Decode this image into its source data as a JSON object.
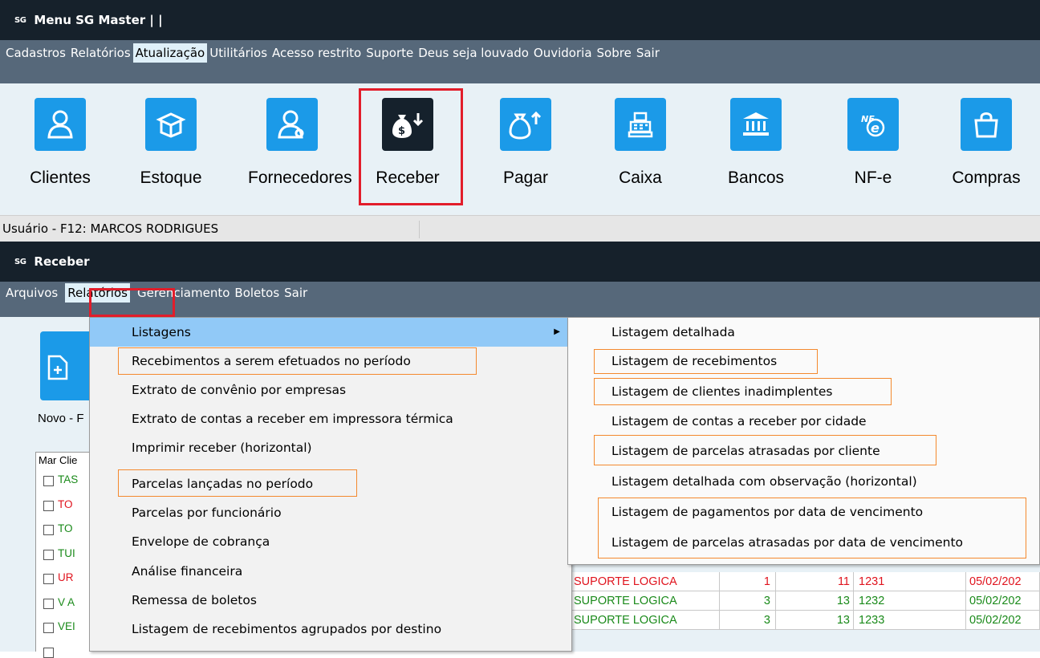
{
  "main_window": {
    "logo": "SG",
    "title": "Menu SG Master | |",
    "menu": [
      "Cadastros",
      "Relatórios",
      "Atualização",
      "Utilitários",
      "Acesso restrito",
      "Suporte",
      "Deus seja louvado",
      "Ouvidoria",
      "Sobre",
      "Sair"
    ],
    "selected_menu": "Atualização",
    "tools": [
      {
        "label": "Clientes",
        "icon": "user-icon"
      },
      {
        "label": "Estoque",
        "icon": "box-icon"
      },
      {
        "label": "Fornecedores",
        "icon": "supplier-icon"
      },
      {
        "label": "Receber",
        "icon": "money-bag-down-icon"
      },
      {
        "label": "Pagar",
        "icon": "money-bag-up-icon"
      },
      {
        "label": "Caixa",
        "icon": "cash-register-icon"
      },
      {
        "label": "Bancos",
        "icon": "bank-icon"
      },
      {
        "label": "NF-e",
        "icon": "nfe-icon"
      },
      {
        "label": "Compras",
        "icon": "shopping-bag-icon"
      }
    ],
    "status": "Usuário - F12: MARCOS RODRIGUES"
  },
  "receber_window": {
    "logo": "SG",
    "title": "Receber",
    "menu": [
      "Arquivos",
      "Relatórios",
      "Gerenciamento",
      "Boletos",
      "Sair"
    ],
    "new_button_label": "Novo - F",
    "grid_header": "Mar Clie",
    "grid_rows": [
      {
        "client": "TAS",
        "color": "#1a8a1a"
      },
      {
        "client": "TO",
        "color": "#e0141e"
      },
      {
        "client": "TO",
        "color": "#1a8a1a"
      },
      {
        "client": "TUI",
        "color": "#1a8a1a"
      },
      {
        "client": "UR",
        "color": "#e0141e"
      },
      {
        "client": "V A",
        "color": "#1a8a1a"
      },
      {
        "client": "VEI",
        "color": "#1a8a1a"
      },
      {
        "client": "",
        "color": "#1a8a1a"
      }
    ],
    "grid_visible_rows": [
      {
        "dest": "SUPORTE LOGICA",
        "a": "1",
        "b": "11",
        "doc": "1231",
        "date": "05/02/202",
        "color": "#e0141e"
      },
      {
        "dest": "SUPORTE LOGICA",
        "a": "3",
        "b": "13",
        "doc": "1232",
        "date": "05/02/202",
        "color": "#1a8a1a"
      },
      {
        "dest": "SUPORTE LOGICA",
        "a": "3",
        "b": "13",
        "doc": "1233",
        "date": "05/02/202",
        "color": "#1a8a1a"
      }
    ]
  },
  "relatorios_menu": [
    "Listagens",
    "Recebimentos a serem efetuados no período",
    "Extrato de convênio por empresas",
    "Extrato de contas a receber em impressora térmica",
    "Imprimir receber (horizontal)",
    "Parcelas lançadas no período",
    "Parcelas por funcionário",
    "Envelope de cobrança",
    "Análise financeira",
    "Remessa de boletos",
    "Listagem de recebimentos agrupados por destino"
  ],
  "listagens_submenu": [
    "Listagem detalhada",
    "Listagem de recebimentos",
    "Listagem de clientes inadimplentes",
    "Listagem de contas a receber por cidade",
    "Listagem de parcelas atrasadas por cliente",
    "Listagem detalhada com observação (horizontal)",
    "Listagem de pagamentos por data de vencimento",
    "Listagem de parcelas atrasadas por data de vencimento"
  ],
  "colors": {
    "title_bg": "#16212b",
    "menubar_bg": "#56687a",
    "tile_blue": "#1b9ae8",
    "highlight_red": "#e21d2a",
    "highlight_orange": "#f4892e",
    "menu_selection": "#91c9f7"
  }
}
